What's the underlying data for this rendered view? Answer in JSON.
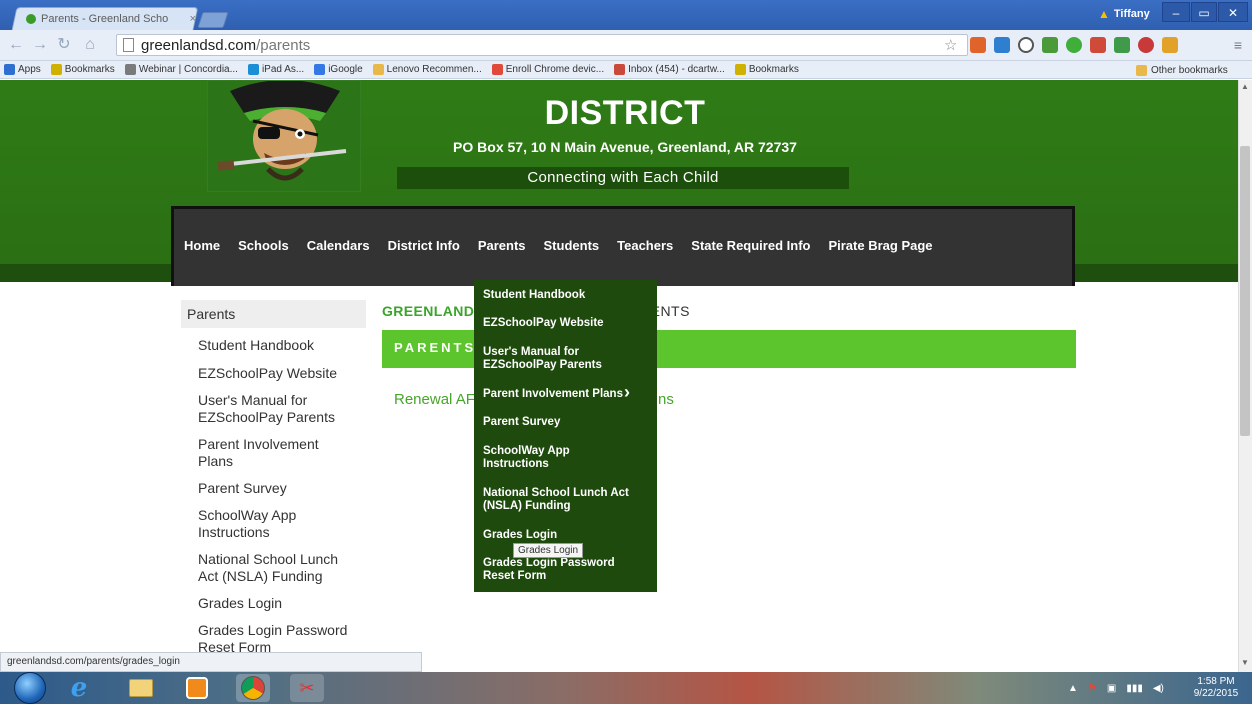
{
  "browser": {
    "tab_title": "Parents - Greenland Scho",
    "tab_close": "×",
    "user_name": "Tiffany",
    "url_domain": "greenlandsd.com",
    "url_path": "/parents",
    "window_controls": [
      "–",
      "▭",
      "✕"
    ],
    "bookmarks": [
      {
        "label": "Apps",
        "icon": "apps-grid-icon",
        "color": "#2f6fd0"
      },
      {
        "label": "Bookmarks",
        "icon": "star-icon",
        "color": "#d0b000"
      },
      {
        "label": "Webinar | Concordia...",
        "icon": "shield-icon",
        "color": "#7a7a7a"
      },
      {
        "label": "iPad As...",
        "icon": "globe-icon",
        "color": "#1b8fd6"
      },
      {
        "label": "iGoogle",
        "icon": "google-icon",
        "color": "#3478e5"
      },
      {
        "label": "Lenovo Recommen...",
        "icon": "folder-icon",
        "color": "#e8b84a"
      },
      {
        "label": "Enroll Chrome devic...",
        "icon": "google-g-icon",
        "color": "#e04a3a"
      },
      {
        "label": "Inbox (454) - dcartw...",
        "icon": "mail-icon",
        "color": "#c94a3a"
      },
      {
        "label": "Bookmarks",
        "icon": "star-icon",
        "color": "#d0b000"
      }
    ],
    "other_bookmarks": "Other bookmarks",
    "status_url": "greenlandsd.com/parents/grades_login"
  },
  "site": {
    "title": "DISTRICT",
    "address": "PO Box 57, 10 N Main Avenue, Greenland, AR 72737",
    "tagline": "Connecting with Each Child",
    "nav": [
      "Home",
      "Schools",
      "Calendars",
      "District Info",
      "Parents",
      "Students",
      "Teachers",
      "State Required Info",
      "Pirate Brag Page"
    ],
    "left_nav_heading": "Parents",
    "left_nav": [
      "Student Handbook",
      "EZSchoolPay Website",
      "User's Manual for EZSchoolPay Parents",
      "Parent Involvement Plans",
      "Parent Survey",
      "SchoolWay App Instructions",
      "National School Lunch Act (NSLA) Funding",
      "Grades Login",
      "Grades Login Password Reset Form"
    ],
    "main_heading_visible": "GREENLAND",
    "main_heading_tail": "RENTS",
    "green_bar_visible": "PARENTS",
    "renewal_visible": "Renewal AF",
    "renewal_tail": "ns",
    "dropdown": [
      "Student Handbook",
      "EZSchoolPay Website",
      "User's Manual for EZSchoolPay Parents",
      "Parent Involvement Plans",
      "Parent Survey",
      "SchoolWay App Instructions",
      "National School Lunch Act (NSLA) Funding",
      "Grades Login",
      "Grades Login Password Reset Form"
    ],
    "tooltip": "Grades Login",
    "colors": {
      "header_green": "#2f7c16",
      "accent_green": "#5cc42c",
      "dropdown_bg": "#1f4a0d",
      "nav_bg": "#333333"
    }
  },
  "taskbar": {
    "time": "1:58 PM",
    "date": "9/22/2015"
  }
}
